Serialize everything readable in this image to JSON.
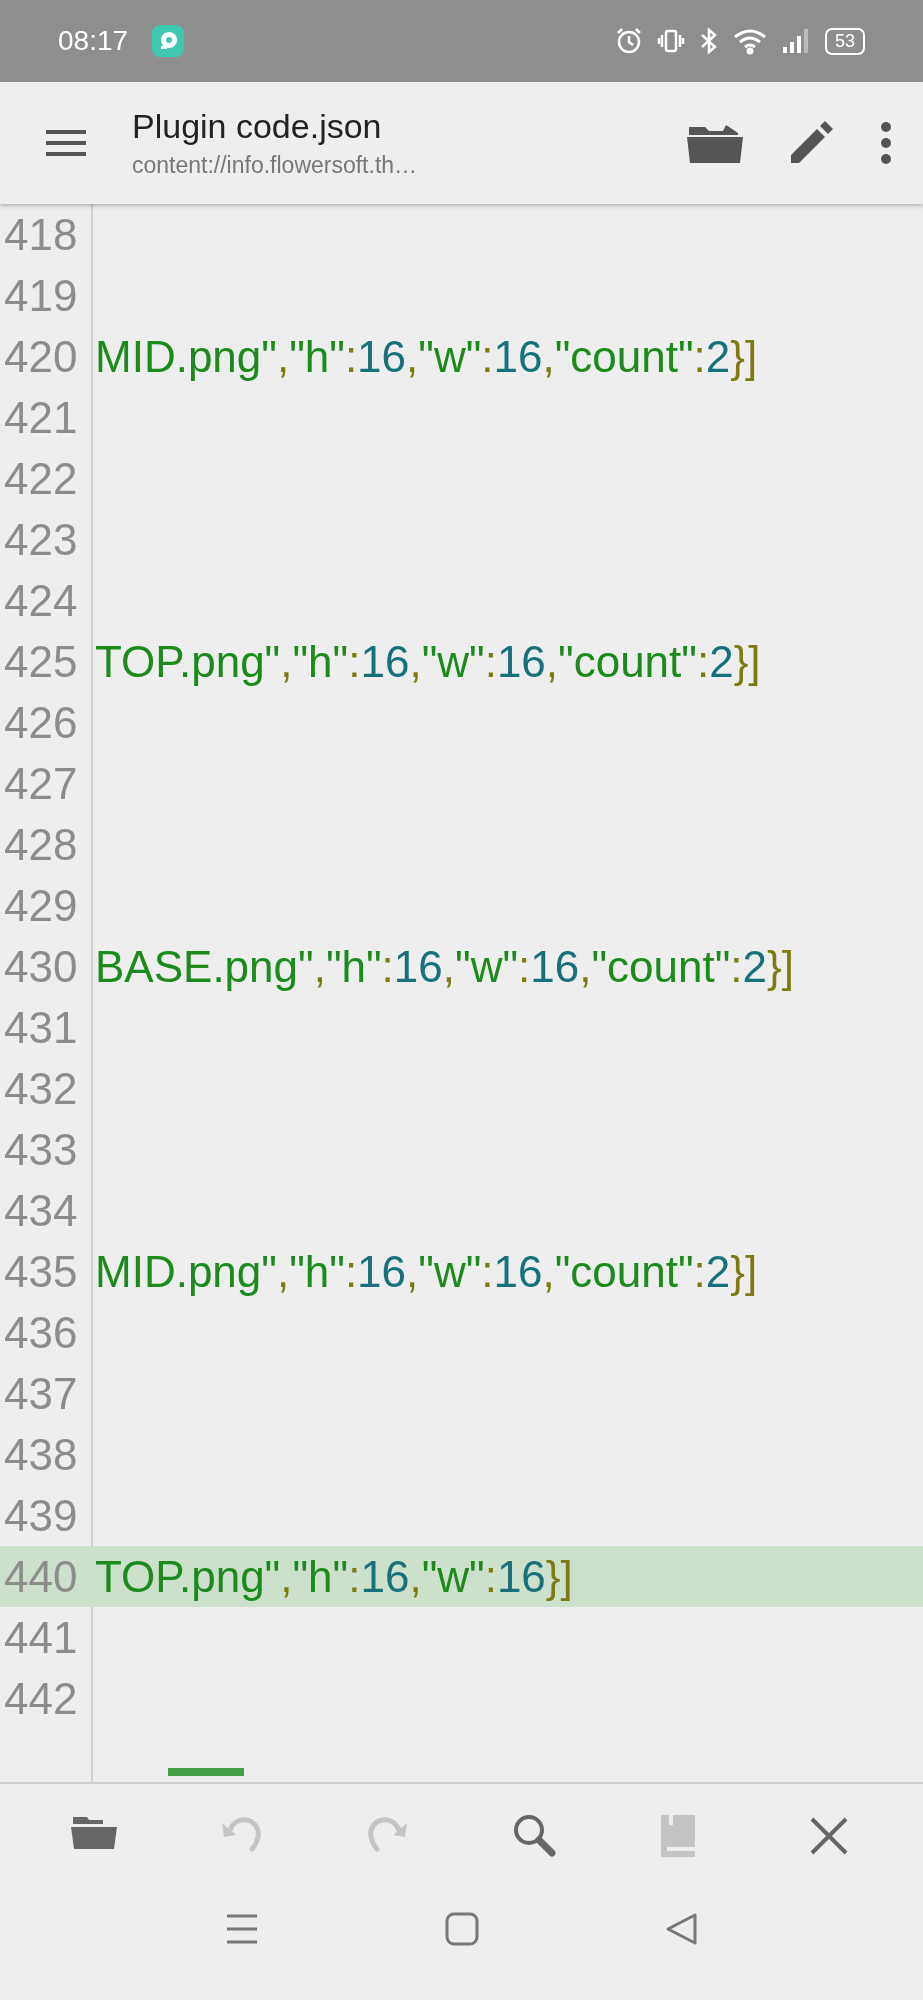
{
  "status_bar": {
    "time": "08:17",
    "battery": "53"
  },
  "toolbar": {
    "title": "Plugin code.json",
    "subtitle": "content://info.flowersoft.th…"
  },
  "editor": {
    "lines": [
      {
        "number": "418",
        "selected": false
      },
      {
        "number": "419",
        "selected": false
      },
      {
        "number": "420",
        "selected": false,
        "tokens": [
          {
            "kind": "str",
            "t": "MID.png\""
          },
          {
            "kind": "punct",
            "t": ","
          },
          {
            "kind": "str",
            "t": "\"h\""
          },
          {
            "kind": "punct",
            "t": ":"
          },
          {
            "kind": "num",
            "t": "16"
          },
          {
            "kind": "punct",
            "t": ","
          },
          {
            "kind": "str",
            "t": "\"w\""
          },
          {
            "kind": "punct",
            "t": ":"
          },
          {
            "kind": "num",
            "t": "16"
          },
          {
            "kind": "punct",
            "t": ","
          },
          {
            "kind": "str",
            "t": "\"count\""
          },
          {
            "kind": "punct",
            "t": ":"
          },
          {
            "kind": "num",
            "t": "2"
          },
          {
            "kind": "punct",
            "t": "}]"
          }
        ]
      },
      {
        "number": "421",
        "selected": false
      },
      {
        "number": "422",
        "selected": false
      },
      {
        "number": "423",
        "selected": false
      },
      {
        "number": "424",
        "selected": false
      },
      {
        "number": "425",
        "selected": false,
        "tokens": [
          {
            "kind": "str",
            "t": "TOP.png\""
          },
          {
            "kind": "punct",
            "t": ","
          },
          {
            "kind": "str",
            "t": "\"h\""
          },
          {
            "kind": "punct",
            "t": ":"
          },
          {
            "kind": "num",
            "t": "16"
          },
          {
            "kind": "punct",
            "t": ","
          },
          {
            "kind": "str",
            "t": "\"w\""
          },
          {
            "kind": "punct",
            "t": ":"
          },
          {
            "kind": "num",
            "t": "16"
          },
          {
            "kind": "punct",
            "t": ","
          },
          {
            "kind": "str",
            "t": "\"count\""
          },
          {
            "kind": "punct",
            "t": ":"
          },
          {
            "kind": "num",
            "t": "2"
          },
          {
            "kind": "punct",
            "t": "}]"
          }
        ]
      },
      {
        "number": "426",
        "selected": false
      },
      {
        "number": "427",
        "selected": false
      },
      {
        "number": "428",
        "selected": false
      },
      {
        "number": "429",
        "selected": false
      },
      {
        "number": "430",
        "selected": false,
        "tokens": [
          {
            "kind": "str",
            "t": "BASE.png\""
          },
          {
            "kind": "punct",
            "t": ","
          },
          {
            "kind": "str",
            "t": "\"h\""
          },
          {
            "kind": "punct",
            "t": ":"
          },
          {
            "kind": "num",
            "t": "16"
          },
          {
            "kind": "punct",
            "t": ","
          },
          {
            "kind": "str",
            "t": "\"w\""
          },
          {
            "kind": "punct",
            "t": ":"
          },
          {
            "kind": "num",
            "t": "16"
          },
          {
            "kind": "punct",
            "t": ","
          },
          {
            "kind": "str",
            "t": "\"count\""
          },
          {
            "kind": "punct",
            "t": ":"
          },
          {
            "kind": "num",
            "t": "2"
          },
          {
            "kind": "punct",
            "t": "}]"
          }
        ]
      },
      {
        "number": "431",
        "selected": false
      },
      {
        "number": "432",
        "selected": false
      },
      {
        "number": "433",
        "selected": false
      },
      {
        "number": "434",
        "selected": false
      },
      {
        "number": "435",
        "selected": false,
        "tokens": [
          {
            "kind": "str",
            "t": "MID.png\""
          },
          {
            "kind": "punct",
            "t": ","
          },
          {
            "kind": "str",
            "t": "\"h\""
          },
          {
            "kind": "punct",
            "t": ":"
          },
          {
            "kind": "num",
            "t": "16"
          },
          {
            "kind": "punct",
            "t": ","
          },
          {
            "kind": "str",
            "t": "\"w\""
          },
          {
            "kind": "punct",
            "t": ":"
          },
          {
            "kind": "num",
            "t": "16"
          },
          {
            "kind": "punct",
            "t": ","
          },
          {
            "kind": "str",
            "t": "\"count\""
          },
          {
            "kind": "punct",
            "t": ":"
          },
          {
            "kind": "num",
            "t": "2"
          },
          {
            "kind": "punct",
            "t": "}]"
          }
        ]
      },
      {
        "number": "436",
        "selected": false
      },
      {
        "number": "437",
        "selected": false
      },
      {
        "number": "438",
        "selected": false
      },
      {
        "number": "439",
        "selected": false
      },
      {
        "number": "440",
        "selected": true,
        "tokens": [
          {
            "kind": "str",
            "t": "TOP.png\""
          },
          {
            "kind": "punct",
            "t": ","
          },
          {
            "kind": "str",
            "t": "\"h\""
          },
          {
            "kind": "punct",
            "t": ":"
          },
          {
            "kind": "num",
            "t": "16"
          },
          {
            "kind": "punct",
            "t": ","
          },
          {
            "kind": "str",
            "t": "\"w\""
          },
          {
            "kind": "punct",
            "t": ":"
          },
          {
            "kind": "num",
            "t": "16"
          },
          {
            "kind": "punct",
            "t": "}]"
          }
        ]
      },
      {
        "number": "441",
        "selected": false
      },
      {
        "number": "442",
        "selected": false
      }
    ]
  },
  "bottom_toolbar": [
    {
      "kind": "open",
      "disabled": false
    },
    {
      "kind": "undo",
      "disabled": true
    },
    {
      "kind": "redo",
      "disabled": true
    },
    {
      "kind": "search",
      "disabled": false
    },
    {
      "kind": "save",
      "disabled": true
    },
    {
      "kind": "close",
      "disabled": false
    }
  ]
}
